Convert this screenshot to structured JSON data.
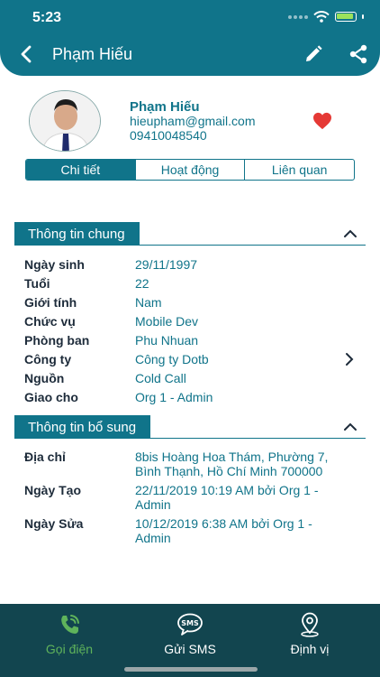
{
  "status_bar": {
    "time": "5:23"
  },
  "header": {
    "title": "Phạm Hiếu"
  },
  "profile": {
    "name": "Phạm Hiếu",
    "email": "hieupham@gmail.com",
    "phone": "09410048540",
    "favorite_color": "#e53935"
  },
  "tabs": [
    {
      "label": "Chi tiết",
      "active": true
    },
    {
      "label": "Hoạt động",
      "active": false
    },
    {
      "label": "Liên quan",
      "active": false
    }
  ],
  "general": {
    "title": "Thông tin chung",
    "rows": [
      {
        "label": "Ngày sinh",
        "value": "29/11/1997"
      },
      {
        "label": "Tuổi",
        "value": "22"
      },
      {
        "label": "Giới tính",
        "value": "Nam"
      },
      {
        "label": "Chức vụ",
        "value": "Mobile Dev"
      },
      {
        "label": "Phòng ban",
        "value": "Phu Nhuan"
      },
      {
        "label": "Công ty",
        "value": "Công ty Dotb"
      },
      {
        "label": "Nguồn",
        "value": "Cold Call"
      },
      {
        "label": "Giao cho",
        "value": "Org 1 - Admin"
      }
    ]
  },
  "additional": {
    "title": "Thông tin bổ sung",
    "rows": [
      {
        "label": "Địa chỉ",
        "value_line1": "8bis Hoàng Hoa Thám, Phường 7,",
        "value_line2": "Bình Thạnh, Hồ Chí Minh 700000"
      },
      {
        "label": "Ngày Tạo",
        "value_line1": "22/11/2019 10:19 AM bởi Org 1 -",
        "value_line2": "Admin"
      },
      {
        "label": "Ngày Sửa",
        "value_line1": "10/12/2019 6:38 AM bởi Org 1 -",
        "value_line2": "Admin"
      }
    ]
  },
  "bottom_nav": [
    {
      "label": "Gọi điện",
      "icon": "phone-icon",
      "active": true
    },
    {
      "label": "Gửi SMS",
      "icon": "sms-icon",
      "active": false
    },
    {
      "label": "Định vị",
      "icon": "location-pin-icon",
      "active": false
    }
  ],
  "colors": {
    "primary": "#10748a",
    "bottom_bar": "#12454f",
    "active_nav": "#5fb35b"
  }
}
